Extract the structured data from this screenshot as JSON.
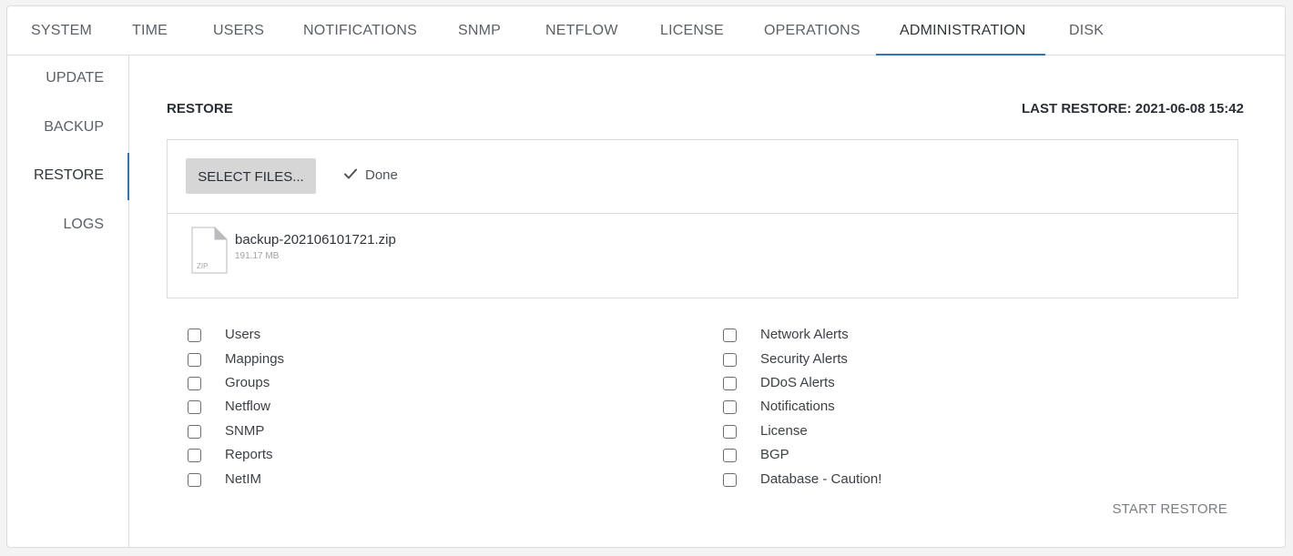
{
  "tabs": [
    {
      "label": "SYSTEM"
    },
    {
      "label": "TIME"
    },
    {
      "label": "USERS"
    },
    {
      "label": "NOTIFICATIONS"
    },
    {
      "label": "SNMP"
    },
    {
      "label": "NETFLOW"
    },
    {
      "label": "LICENSE"
    },
    {
      "label": "OPERATIONS"
    },
    {
      "label": "ADMINISTRATION",
      "active": true
    },
    {
      "label": "DISK"
    }
  ],
  "sidebar": {
    "items": [
      {
        "label": "UPDATE"
      },
      {
        "label": "BACKUP"
      },
      {
        "label": "RESTORE",
        "active": true
      },
      {
        "label": "LOGS"
      }
    ]
  },
  "restore": {
    "title": "RESTORE",
    "last_restore": "LAST RESTORE: 2021-06-08 15:42",
    "select_files_label": "SELECT FILES...",
    "upload_status": "Done",
    "file": {
      "name": "backup-202106101721.zip",
      "size": "191.17 MB",
      "type_label": "ZIP"
    },
    "options_left": [
      {
        "label": "Users",
        "checked": false
      },
      {
        "label": "Mappings",
        "checked": false
      },
      {
        "label": "Groups",
        "checked": false
      },
      {
        "label": "Netflow",
        "checked": false
      },
      {
        "label": "SNMP",
        "checked": false
      },
      {
        "label": "Reports",
        "checked": false
      },
      {
        "label": "NetIM",
        "checked": false
      }
    ],
    "options_right": [
      {
        "label": "Network Alerts",
        "checked": false
      },
      {
        "label": "Security Alerts",
        "checked": false
      },
      {
        "label": "DDoS Alerts",
        "checked": false
      },
      {
        "label": "Notifications",
        "checked": false
      },
      {
        "label": "License",
        "checked": false
      },
      {
        "label": "BGP",
        "checked": false
      },
      {
        "label": "Database - Caution!",
        "checked": false
      }
    ],
    "start_restore_label": "START RESTORE"
  },
  "colors": {
    "accent": "#2f76b8",
    "border": "#dcdcdc",
    "button_bg": "#d6d6d6"
  },
  "icons": {
    "done": "checkmark-icon",
    "file": "zip-file-icon"
  }
}
